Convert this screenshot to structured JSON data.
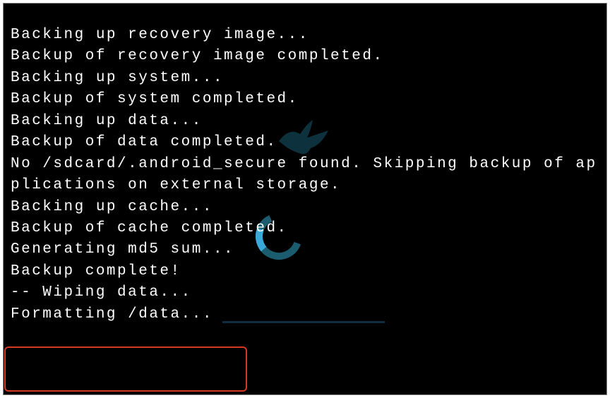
{
  "terminal": {
    "lines": [
      "Backing up recovery image...",
      "Backup of recovery image completed.",
      "Backing up system...",
      "Backup of system completed.",
      "Backing up data...",
      "Backup of data completed.",
      "No /sdcard/.android_secure found. Skipping backup of ap",
      "plications on external storage.",
      "Backing up cache...",
      "Backup of cache completed.",
      "Generating md5 sum...",
      "",
      "Backup complete!",
      "",
      "-- Wiping data...",
      "Formatting /data..."
    ]
  }
}
